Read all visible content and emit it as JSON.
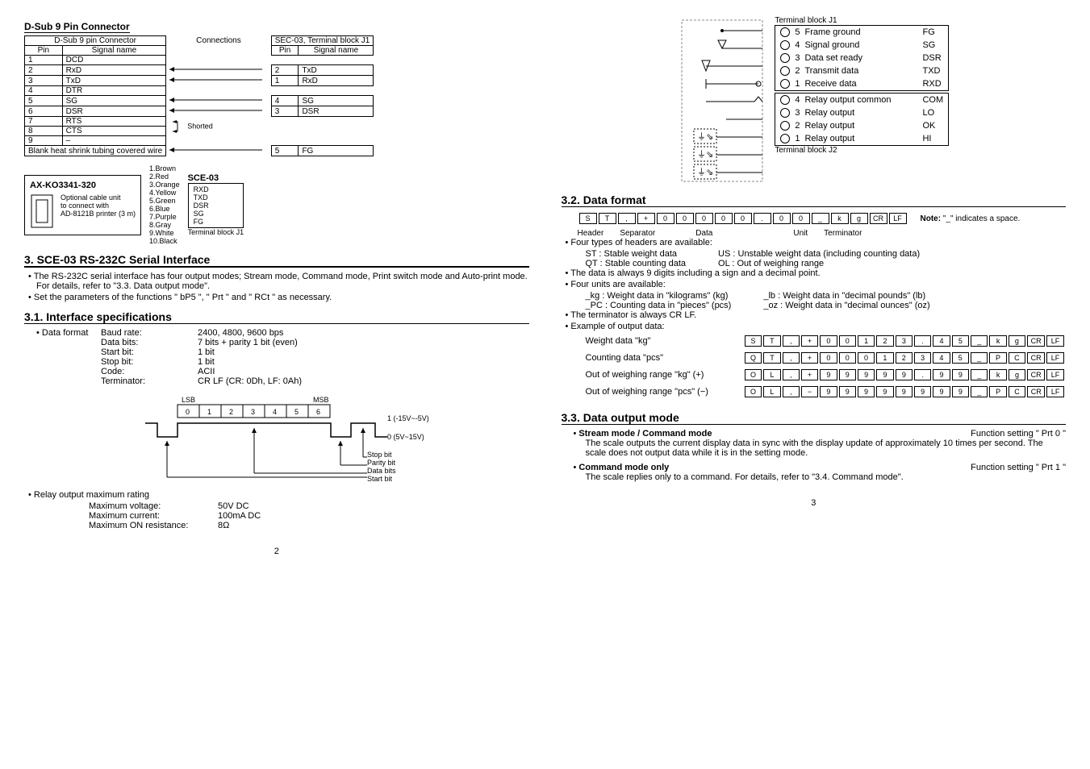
{
  "page2": {
    "subsection_dsub": "D-Sub 9 Pin Connector",
    "conn_table": {
      "h1": "D-Sub 9 pin Connector",
      "h2": "Connections",
      "h3": "SEC-03, Terminal block J1",
      "pin": "Pin",
      "sig": "Signal name",
      "rows": [
        {
          "p": "1",
          "s": "DCD",
          "p2": "",
          "s2": ""
        },
        {
          "p": "2",
          "s": "RxD",
          "p2": "2",
          "s2": "TxD"
        },
        {
          "p": "3",
          "s": "TxD",
          "p2": "1",
          "s2": "RxD"
        },
        {
          "p": "4",
          "s": "DTR",
          "p2": "",
          "s2": ""
        },
        {
          "p": "5",
          "s": "SG",
          "p2": "4",
          "s2": "SG"
        },
        {
          "p": "6",
          "s": "DSR",
          "p2": "3",
          "s2": "DSR"
        },
        {
          "p": "7",
          "s": "RTS",
          "p2": "",
          "s2": ""
        },
        {
          "p": "8",
          "s": "CTS",
          "p2": "",
          "s2": ""
        },
        {
          "p": "9",
          "s": "–",
          "p2": "",
          "s2": ""
        }
      ],
      "shorted": "Shorted",
      "blank": "Blank heat shrink tubing covered wire",
      "fg_pin": "5",
      "fg": "FG"
    },
    "ax_label": "AX-KO3341-320",
    "opt_cable": "Optional cable unit\nto connect with\nAD-8121B printer (3 m)",
    "sce03": "SCE-03",
    "wires": [
      "1.Brown",
      "2.Red",
      "3.Orange",
      "4.Yellow",
      "5.Green",
      "6.Blue",
      "7.Purple",
      "8.Gray",
      "9.White",
      "10.Black"
    ],
    "sce_pins": [
      "RXD",
      "TXD",
      "DSR",
      "SG",
      "FG"
    ],
    "term_j1": "Terminal block J1",
    "s3_title": "3. SCE-03 RS-232C Serial Interface",
    "s3_b1": "The RS-232C serial interface has four output modes; Stream mode, Command mode, Print switch mode and Auto-print mode. For details, refer to \"3.3. Data output mode\".",
    "s3_b2": "Set the parameters of the functions \" bP5 \", \" Prt \" and \" RCt \" as necessary.",
    "s31_title": "3.1. Interface specifications",
    "specs": {
      "df": "Data format",
      "bd": "Baud rate:",
      "bdv": "2400, 4800, 9600 bps",
      "db": "Data bits:",
      "dbv": "7 bits + parity 1 bit (even)",
      "sb": "Start bit:",
      "sbv": "1 bit",
      "st": "Stop bit:",
      "stv": "1 bit",
      "cd": "Code:",
      "cdv": "ACII",
      "tm": "Terminator:",
      "tmv": "CR LF   (CR: 0Dh, LF: 0Ah)"
    },
    "bitdiag": {
      "lsb": "LSB",
      "msb": "MSB",
      "b0": "0",
      "b1": "1",
      "b2": "2",
      "b3": "3",
      "b4": "4",
      "b5": "5",
      "b6": "6",
      "hi": "1 (-15V~-5V)",
      "lo": "0 (5V~15V)",
      "stop": "Stop bit",
      "par": "Parity bit",
      "db": "Data bits",
      "start": "Start bit"
    },
    "relay_title": "Relay output maximum rating",
    "relay": {
      "mv": "Maximum voltage:",
      "mvv": "50V DC",
      "mc": "Maximum current:",
      "mcv": "100mA DC",
      "mr": "Maximum ON resistance:",
      "mrv": "8Ω"
    },
    "pnum": "2"
  },
  "page3": {
    "tb_j1": "Terminal block J1",
    "tb_j2": "Terminal block J2",
    "term_rows": [
      {
        "n": "5",
        "t": "Frame ground",
        "c": "FG"
      },
      {
        "n": "4",
        "t": "Signal ground",
        "c": "SG"
      },
      {
        "n": "3",
        "t": "Data set ready",
        "c": "DSR"
      },
      {
        "n": "2",
        "t": "Transmit data",
        "c": "TXD"
      },
      {
        "n": "1",
        "t": "Receive data",
        "c": "RXD"
      },
      {
        "n": "4",
        "t": "Relay output common",
        "c": "COM"
      },
      {
        "n": "3",
        "t": "Relay output",
        "c": "LO"
      },
      {
        "n": "2",
        "t": "Relay output",
        "c": "OK"
      },
      {
        "n": "1",
        "t": "Relay output",
        "c": "HI"
      }
    ],
    "s32": "3.2. Data format",
    "fmt_cells": [
      "S",
      "T",
      ",",
      "+",
      "0",
      "0",
      "0",
      "0",
      "0",
      ".",
      "0",
      "0",
      "_",
      "k",
      "g",
      "CR",
      "LF"
    ],
    "note": "Note:",
    "note_txt": "\"_\" indicates a space.",
    "lbl_header": "Header",
    "lbl_sep": "Separator",
    "lbl_data": "Data",
    "lbl_unit": "Unit",
    "lbl_term": "Terminator",
    "b_four_headers": "Four types of headers are available:",
    "hdr_ST": "ST  : Stable weight data",
    "hdr_US": "US  : Unstable weight data (including counting data)",
    "hdr_QT": "QT  : Stable counting data",
    "hdr_OL": "OL  : Out of weighing range",
    "b_9digits": "The data is always 9 digits including a sign and a decimal point.",
    "b_units": "Four units are available:",
    "u_kg": "_kg   : Weight data in \"kilograms\" (kg)",
    "u_lb": "_lb  : Weight data in \"decimal pounds\" (lb)",
    "u_pc": "_PC  : Counting data in \"pieces\" (pcs)",
    "u_oz": "_oz  : Weight data in \"decimal ounces\" (oz)",
    "b_term": "The terminator is always CR LF.",
    "b_example": "Example of output data:",
    "ex1_lbl": "Weight data \"kg\"",
    "ex1": [
      "S",
      "T",
      ",",
      "+",
      "0",
      "0",
      "1",
      "2",
      "3",
      ".",
      "4",
      "5",
      "_",
      "k",
      "g",
      "CR",
      "LF"
    ],
    "ex2_lbl": "Counting data \"pcs\"",
    "ex2": [
      "Q",
      "T",
      ",",
      "+",
      "0",
      "0",
      "0",
      "1",
      "2",
      "3",
      "4",
      "5",
      "_",
      "P",
      "C",
      "CR",
      "LF"
    ],
    "ex3_lbl": "Out of weighing range \"kg\" (+)",
    "ex3": [
      "O",
      "L",
      ",",
      "+",
      "9",
      "9",
      "9",
      "9",
      "9",
      ".",
      "9",
      "9",
      "_",
      "k",
      "g",
      "CR",
      "LF"
    ],
    "ex4_lbl": "Out of weighing range \"pcs\" (−)",
    "ex4": [
      "O",
      "L",
      ",",
      "−",
      "9",
      "9",
      "9",
      "9",
      "9",
      "9",
      "9",
      "9",
      "_",
      "P",
      "C",
      "CR",
      "LF"
    ],
    "s33": "3.3. Data output mode",
    "m1": "Stream mode / Command mode",
    "m1f": "Function setting \" Prt  0 \"",
    "m1t": "The scale outputs the current display data in sync with the display update of approximately 10 times per second. The scale does not output data while it is in the setting mode.",
    "m2": "Command mode only",
    "m2f": "Function setting \" Prt  1 \"",
    "m2t": "The scale replies only to a command. For details, refer to \"3.4. Command mode\".",
    "pnum": "3"
  }
}
